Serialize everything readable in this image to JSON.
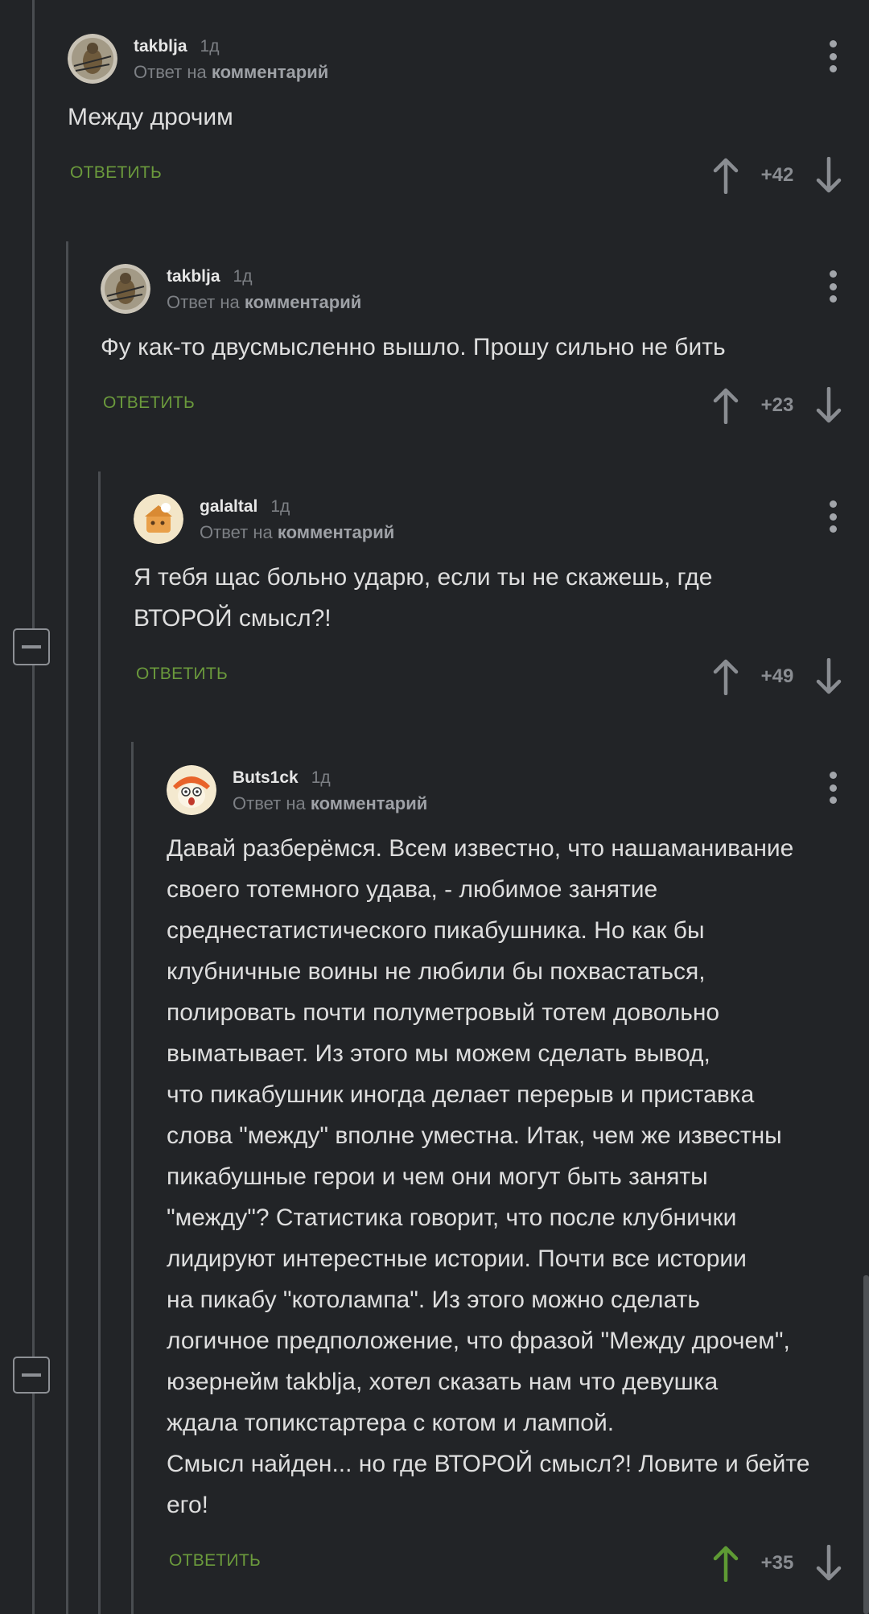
{
  "comments": [
    {
      "username": "takblja",
      "time": "1д",
      "reply_prefix": "Ответ на",
      "reply_target": "комментарий",
      "text": "Между дрочим",
      "reply_label": "ОТВЕТИТЬ",
      "rating": "+42"
    },
    {
      "username": "takblja",
      "time": "1д",
      "reply_prefix": "Ответ на",
      "reply_target": "комментарий",
      "text": "Фу как-то двусмысленно вышло. Прошу сильно не бить",
      "reply_label": "ОТВЕТИТЬ",
      "rating": "+23"
    },
    {
      "username": "galaltal",
      "time": "1д",
      "reply_prefix": "Ответ на",
      "reply_target": "комментарий",
      "text": "Я тебя щас больно ударю, если ты не скажешь, где\nВТОРОЙ смысл?!",
      "reply_label": "ОТВЕТИТЬ",
      "rating": "+49"
    },
    {
      "username": "Buts1ck",
      "time": "1д",
      "reply_prefix": "Ответ на",
      "reply_target": "комментарий",
      "text": "Давай разберёмся. Всем известно, что нашаманивание\nсвоего тотемного удава, - любимое занятие\nсреднестатистического пикабушника. Но как бы\nклубничные воины не любили бы похвастаться,\nполировать почти полуметровый тотем довольно\nвыматывает. Из этого мы можем сделать вывод,\nчто пикабушник иногда делает перерыв и приставка\nслова \"между\" вполне уместна. Итак, чем же известны\nпикабушные герои и чем они могут быть заняты\n\"между\"? Статистика говорит, что после клубнички\nлидируют интерестные истории. Почти все истории\nна пикабу \"котолампа\". Из этого можно сделать\nлогичное предположение, что фразой \"Между дрочем\",\nюзернейм takblja, хотел сказать нам что девушка\nждала топикстартера с котом и лампой.\nСмысл найден... но где ВТОРОЙ смысл?! Ловите и бейте\nего!",
      "reply_label": "ОТВЕТИТЬ",
      "rating": "+35"
    }
  ],
  "colors": {
    "background": "#222427",
    "reply_green": "#6b9a3c",
    "upvoted_green": "#5e9a34",
    "muted_gray": "#8a8d92"
  },
  "icons": {
    "upvote": "arrow-up-icon",
    "downvote": "arrow-down-icon",
    "more": "more-vertical-icon",
    "collapse": "minus-icon"
  }
}
